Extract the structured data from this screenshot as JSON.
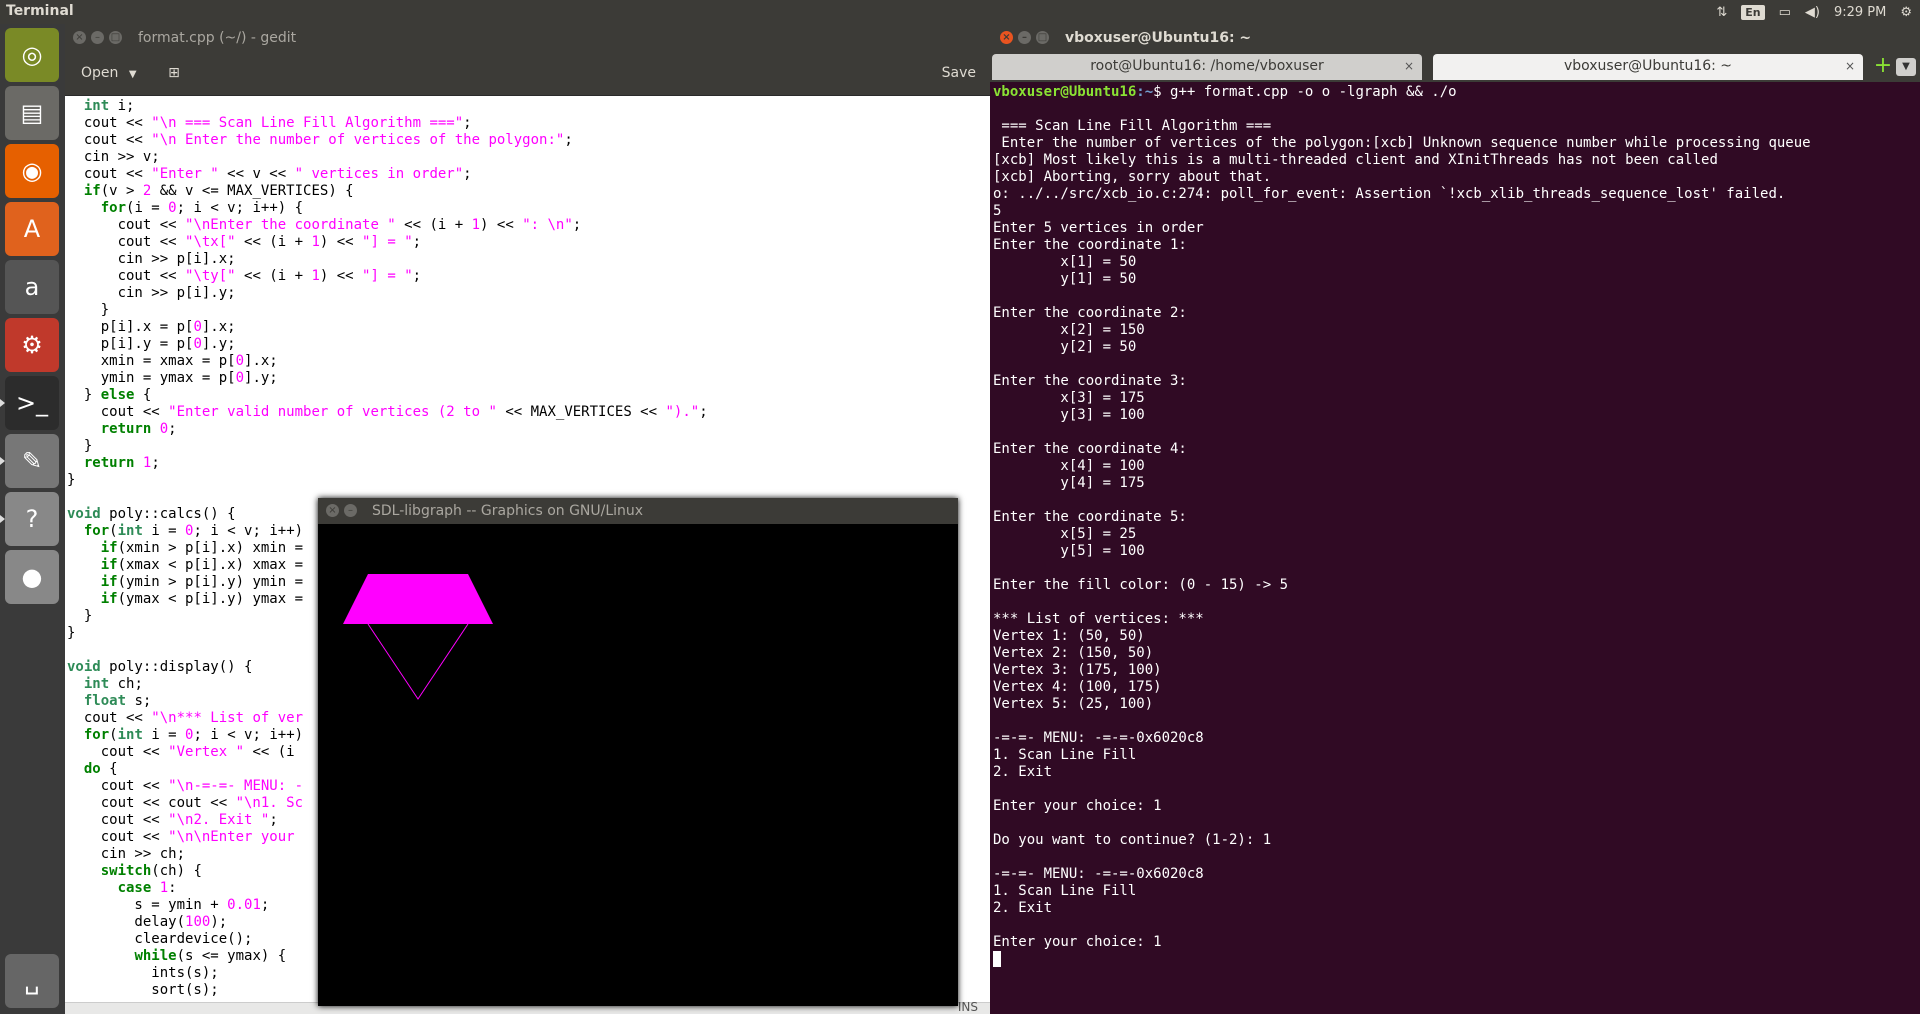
{
  "top_panel": {
    "app_name": "Terminal",
    "keyboard_layout": "En",
    "clock": "9:29 PM"
  },
  "launcher": {
    "items": [
      {
        "name": "ubuntu-dash-icon",
        "glyph": "◎",
        "color": "#7a8a26",
        "running": false
      },
      {
        "name": "files-icon",
        "glyph": "▤",
        "color": "#6b6a66",
        "running": false
      },
      {
        "name": "firefox-icon",
        "glyph": "◉",
        "color": "#e66000",
        "running": false
      },
      {
        "name": "software-center-icon",
        "glyph": "A",
        "color": "#e0621d",
        "running": false
      },
      {
        "name": "amazon-icon",
        "glyph": "a",
        "color": "#555555",
        "running": false
      },
      {
        "name": "system-settings-icon",
        "glyph": "⚙",
        "color": "#c0392b",
        "running": false
      },
      {
        "name": "terminal-icon",
        "glyph": ">_",
        "color": "#2c2c2c",
        "running": true
      },
      {
        "name": "text-editor-icon",
        "glyph": "✎",
        "color": "#777777",
        "running": true
      },
      {
        "name": "help-icon",
        "glyph": "?",
        "color": "#888888",
        "running": true
      },
      {
        "name": "dvd-icon",
        "glyph": "●",
        "color": "#888888",
        "running": false
      },
      {
        "name": "trash-icon",
        "glyph": "␣",
        "color": "#666666",
        "running": false
      }
    ]
  },
  "gedit": {
    "title": "format.cpp (~/) - gedit",
    "open_label": "Open",
    "save_label": "Save",
    "status_ins": "INS",
    "code_lines": [
      [
        [
          "",
          "  "
        ],
        [
          "ty",
          "int"
        ],
        [
          "",
          " i;"
        ]
      ],
      [
        [
          "",
          "  cout << "
        ],
        [
          "str",
          "\"\\n === Scan Line Fill Algorithm ===\""
        ],
        [
          "",
          ";"
        ]
      ],
      [
        [
          "",
          "  cout << "
        ],
        [
          "str",
          "\"\\n Enter the number of vertices of the polygon:\""
        ],
        [
          "",
          ";"
        ]
      ],
      [
        [
          "",
          "  cin >> v;"
        ]
      ],
      [
        [
          "",
          "  cout << "
        ],
        [
          "str",
          "\"Enter \""
        ],
        [
          "",
          " << v << "
        ],
        [
          "str",
          "\" vertices in order\""
        ],
        [
          "",
          ";"
        ]
      ],
      [
        [
          "",
          "  "
        ],
        [
          "kw",
          "if"
        ],
        [
          "",
          "(v > "
        ],
        [
          "num",
          "2"
        ],
        [
          "",
          " && v <= MAX_VERTICES) {"
        ]
      ],
      [
        [
          "",
          "    "
        ],
        [
          "kw",
          "for"
        ],
        [
          "",
          "(i = "
        ],
        [
          "num",
          "0"
        ],
        [
          "",
          "; i < v; i++) {"
        ]
      ],
      [
        [
          "",
          "      cout << "
        ],
        [
          "str",
          "\"\\nEnter the coordinate \""
        ],
        [
          "",
          " << (i + "
        ],
        [
          "num",
          "1"
        ],
        [
          "",
          ") << "
        ],
        [
          "str",
          "\": \\n\""
        ],
        [
          "",
          ";"
        ]
      ],
      [
        [
          "",
          "      cout << "
        ],
        [
          "str",
          "\"\\tx[\""
        ],
        [
          "",
          " << (i + "
        ],
        [
          "num",
          "1"
        ],
        [
          "",
          ") << "
        ],
        [
          "str",
          "\"] = \""
        ],
        [
          "",
          ";"
        ]
      ],
      [
        [
          "",
          "      cin >> p[i].x;"
        ]
      ],
      [
        [
          "",
          "      cout << "
        ],
        [
          "str",
          "\"\\ty[\""
        ],
        [
          "",
          " << (i + "
        ],
        [
          "num",
          "1"
        ],
        [
          "",
          ") << "
        ],
        [
          "str",
          "\"] = \""
        ],
        [
          "",
          ";"
        ]
      ],
      [
        [
          "",
          "      cin >> p[i].y;"
        ]
      ],
      [
        [
          "",
          "    }"
        ]
      ],
      [
        [
          "",
          "    p[i].x = p["
        ],
        [
          "num",
          "0"
        ],
        [
          "",
          "].x;"
        ]
      ],
      [
        [
          "",
          "    p[i].y = p["
        ],
        [
          "num",
          "0"
        ],
        [
          "",
          "].y;"
        ]
      ],
      [
        [
          "",
          "    xmin = xmax = p["
        ],
        [
          "num",
          "0"
        ],
        [
          "",
          "].x;"
        ]
      ],
      [
        [
          "",
          "    ymin = ymax = p["
        ],
        [
          "num",
          "0"
        ],
        [
          "",
          "].y;"
        ]
      ],
      [
        [
          "",
          "  } "
        ],
        [
          "kw",
          "else"
        ],
        [
          "",
          " {"
        ]
      ],
      [
        [
          "",
          "    cout << "
        ],
        [
          "str",
          "\"Enter valid number of vertices (2 to \""
        ],
        [
          "",
          " << MAX_VERTICES << "
        ],
        [
          "str",
          "\").\""
        ],
        [
          "",
          ";"
        ]
      ],
      [
        [
          "",
          "    "
        ],
        [
          "kw",
          "return"
        ],
        [
          "",
          " "
        ],
        [
          "num",
          "0"
        ],
        [
          "",
          ";"
        ]
      ],
      [
        [
          "",
          "  }"
        ]
      ],
      [
        [
          "",
          "  "
        ],
        [
          "kw",
          "return"
        ],
        [
          "",
          " "
        ],
        [
          "num",
          "1"
        ],
        [
          "",
          ";"
        ]
      ],
      [
        [
          "",
          "}"
        ]
      ],
      [
        [
          "",
          ""
        ]
      ],
      [
        [
          "ty",
          "void"
        ],
        [
          "",
          " poly::calcs() {"
        ]
      ],
      [
        [
          "",
          "  "
        ],
        [
          "kw",
          "for"
        ],
        [
          "",
          "("
        ],
        [
          "ty",
          "int"
        ],
        [
          "",
          " i = "
        ],
        [
          "num",
          "0"
        ],
        [
          "",
          "; i < v; i++)"
        ]
      ],
      [
        [
          "",
          "    "
        ],
        [
          "kw",
          "if"
        ],
        [
          "",
          "(xmin > p[i].x) xmin ="
        ]
      ],
      [
        [
          "",
          "    "
        ],
        [
          "kw",
          "if"
        ],
        [
          "",
          "(xmax < p[i].x) xmax ="
        ]
      ],
      [
        [
          "",
          "    "
        ],
        [
          "kw",
          "if"
        ],
        [
          "",
          "(ymin > p[i].y) ymin ="
        ]
      ],
      [
        [
          "",
          "    "
        ],
        [
          "kw",
          "if"
        ],
        [
          "",
          "(ymax < p[i].y) ymax ="
        ]
      ],
      [
        [
          "",
          "  }"
        ]
      ],
      [
        [
          "",
          "}"
        ]
      ],
      [
        [
          "",
          ""
        ]
      ],
      [
        [
          "ty",
          "void"
        ],
        [
          "",
          " poly::display() {"
        ]
      ],
      [
        [
          "",
          "  "
        ],
        [
          "ty",
          "int"
        ],
        [
          "",
          " ch;"
        ]
      ],
      [
        [
          "",
          "  "
        ],
        [
          "ty",
          "float"
        ],
        [
          "",
          " s;"
        ]
      ],
      [
        [
          "",
          "  cout << "
        ],
        [
          "str",
          "\"\\n*** List of ver"
        ]
      ],
      [
        [
          "",
          "  "
        ],
        [
          "kw",
          "for"
        ],
        [
          "",
          "("
        ],
        [
          "ty",
          "int"
        ],
        [
          "",
          " i = "
        ],
        [
          "num",
          "0"
        ],
        [
          "",
          "; i < v; i++)"
        ]
      ],
      [
        [
          "",
          "    cout << "
        ],
        [
          "str",
          "\"Vertex \""
        ],
        [
          "",
          " << (i"
        ]
      ],
      [
        [
          "",
          "  "
        ],
        [
          "kw",
          "do"
        ],
        [
          "",
          " {"
        ]
      ],
      [
        [
          "",
          "    cout << "
        ],
        [
          "str",
          "\"\\n-=-=- MENU: -"
        ]
      ],
      [
        [
          "",
          "    cout << cout << "
        ],
        [
          "str",
          "\"\\n1. Sc"
        ]
      ],
      [
        [
          "",
          "    cout << "
        ],
        [
          "str",
          "\"\\n2. Exit \""
        ],
        [
          "",
          ";"
        ]
      ],
      [
        [
          "",
          "    cout << "
        ],
        [
          "str",
          "\"\\n\\nEnter your"
        ]
      ],
      [
        [
          "",
          "    cin >> ch;"
        ]
      ],
      [
        [
          "",
          "    "
        ],
        [
          "kw",
          "switch"
        ],
        [
          "",
          "(ch) {"
        ]
      ],
      [
        [
          "",
          "      "
        ],
        [
          "kw",
          "case"
        ],
        [
          "",
          " "
        ],
        [
          "num",
          "1"
        ],
        [
          "",
          ":"
        ]
      ],
      [
        [
          "",
          "        s = ymin + "
        ],
        [
          "num",
          "0.01"
        ],
        [
          "",
          ";"
        ]
      ],
      [
        [
          "",
          "        delay("
        ],
        [
          "num",
          "100"
        ],
        [
          "",
          ");"
        ]
      ],
      [
        [
          "",
          "        cleardevice();"
        ]
      ],
      [
        [
          "",
          "        "
        ],
        [
          "kw",
          "while"
        ],
        [
          "",
          "(s <= ymax) {"
        ]
      ],
      [
        [
          "",
          "          ints(s);"
        ]
      ],
      [
        [
          "",
          "          sort(s);"
        ]
      ]
    ]
  },
  "sdl_window": {
    "title": "SDL-libgraph -- Graphics on GNU/Linux",
    "fill_color": "#ff00ff"
  },
  "terminal": {
    "title": "vboxuser@Ubuntu16: ~",
    "tabs": [
      {
        "label": "root@Ubuntu16: /home/vboxuser",
        "active": false
      },
      {
        "label": "vboxuser@Ubuntu16: ~",
        "active": true
      }
    ],
    "prompt_user": "vboxuser@Ubuntu16",
    "prompt_path": ":~",
    "prompt_cmd": "$ g++ format.cpp -o o -lgraph && ./o",
    "lines": [
      "",
      " === Scan Line Fill Algorithm ===",
      " Enter the number of vertices of the polygon:[xcb] Unknown sequence number while processing queue",
      "[xcb] Most likely this is a multi-threaded client and XInitThreads has not been called",
      "[xcb] Aborting, sorry about that.",
      "o: ../../src/xcb_io.c:274: poll_for_event: Assertion `!xcb_xlib_threads_sequence_lost' failed.",
      "5",
      "Enter 5 vertices in order",
      "Enter the coordinate 1:",
      "        x[1] = 50",
      "        y[1] = 50",
      "",
      "Enter the coordinate 2:",
      "        x[2] = 150",
      "        y[2] = 50",
      "",
      "Enter the coordinate 3:",
      "        x[3] = 175",
      "        y[3] = 100",
      "",
      "Enter the coordinate 4:",
      "        x[4] = 100",
      "        y[4] = 175",
      "",
      "Enter the coordinate 5:",
      "        x[5] = 25",
      "        y[5] = 100",
      "",
      "Enter the fill color: (0 - 15) -> 5",
      "",
      "*** List of vertices: ***",
      "Vertex 1: (50, 50)",
      "Vertex 2: (150, 50)",
      "Vertex 3: (175, 100)",
      "Vertex 4: (100, 175)",
      "Vertex 5: (25, 100)",
      "",
      "-=-=- MENU: -=-=-0x6020c8",
      "1. Scan Line Fill",
      "2. Exit",
      "",
      "Enter your choice: 1",
      "",
      "Do you want to continue? (1-2): 1",
      "",
      "-=-=- MENU: -=-=-0x6020c8",
      "1. Scan Line Fill",
      "2. Exit",
      "",
      "Enter your choice: 1"
    ]
  }
}
